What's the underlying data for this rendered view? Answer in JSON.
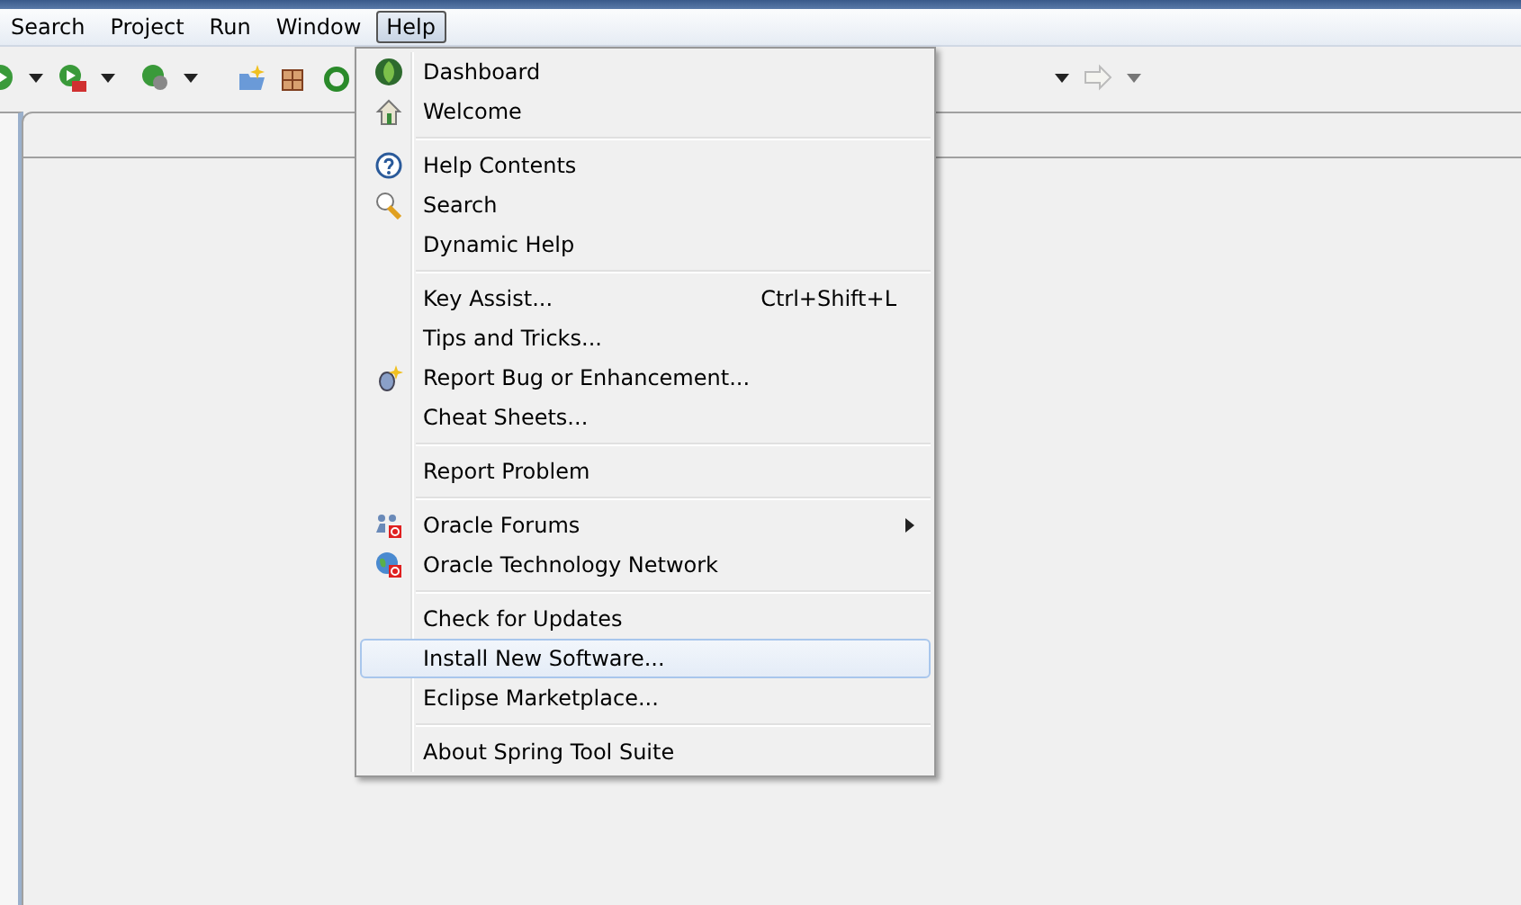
{
  "menu_bar": [
    {
      "label": "Search",
      "selected": false
    },
    {
      "label": "Project",
      "selected": false
    },
    {
      "label": "Run",
      "selected": false
    },
    {
      "label": "Window",
      "selected": false
    },
    {
      "label": "Help",
      "selected": true
    }
  ],
  "help_menu": {
    "groups": [
      {
        "items": [
          {
            "label": "Dashboard",
            "selected": false
          },
          {
            "label": "Welcome",
            "selected": false
          }
        ]
      },
      {
        "items": [
          {
            "label": "Help Contents",
            "selected": false
          },
          {
            "label": "Search",
            "selected": false
          },
          {
            "label": "Dynamic Help",
            "selected": false
          }
        ]
      },
      {
        "items": [
          {
            "label": "Key Assist...",
            "shortcut": "Ctrl+Shift+L",
            "selected": false
          },
          {
            "label": "Tips and Tricks...",
            "selected": false
          },
          {
            "label": "Report Bug or Enhancement...",
            "selected": false
          },
          {
            "label": "Cheat Sheets...",
            "selected": false
          }
        ]
      },
      {
        "items": [
          {
            "label": "Report Problem",
            "selected": false
          }
        ]
      },
      {
        "items": [
          {
            "label": "Oracle Forums",
            "submenu": true,
            "selected": false
          },
          {
            "label": "Oracle Technology Network",
            "selected": false
          }
        ]
      },
      {
        "items": [
          {
            "label": "Check for Updates",
            "selected": false
          },
          {
            "label": "Install New Software...",
            "selected": true
          },
          {
            "label": "Eclipse Marketplace...",
            "selected": false
          }
        ]
      },
      {
        "items": [
          {
            "label": "About Spring Tool Suite",
            "selected": false
          }
        ]
      }
    ]
  }
}
